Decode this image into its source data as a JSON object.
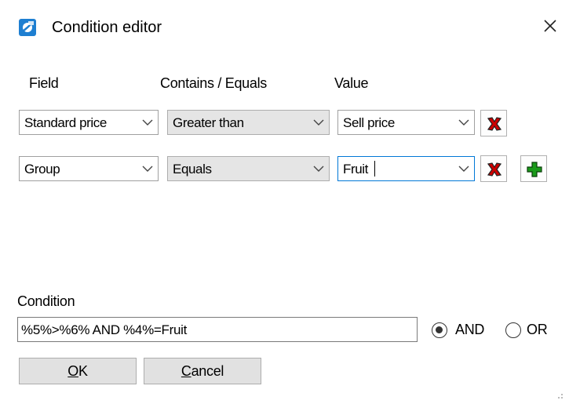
{
  "window": {
    "title": "Condition editor"
  },
  "headers": {
    "field": "Field",
    "operator": "Contains / Equals",
    "value": "Value"
  },
  "rows": [
    {
      "field": "Standard price",
      "operator": "Greater than",
      "value": "Sell price"
    },
    {
      "field": "Group",
      "operator": "Equals",
      "value": "Fruit"
    }
  ],
  "condition": {
    "label": "Condition",
    "expression": "%5%>%6% AND %4%=Fruit"
  },
  "logic": {
    "and_label": "AND",
    "or_label": "OR",
    "selected": "AND"
  },
  "buttons": {
    "ok_prefix": "",
    "ok_accel": "O",
    "ok_rest": "K",
    "cancel_accel": "C",
    "cancel_rest": "ancel"
  },
  "icons": {
    "app": "condition-editor-app-icon",
    "close": "close-icon",
    "delete": "red-x-delete-icon",
    "add": "green-plus-add-icon",
    "dropdown": "chevron-down-icon"
  },
  "colors": {
    "focus_border": "#0078d7",
    "delete_red": "#cc0000",
    "add_green": "#1a9a1a"
  }
}
